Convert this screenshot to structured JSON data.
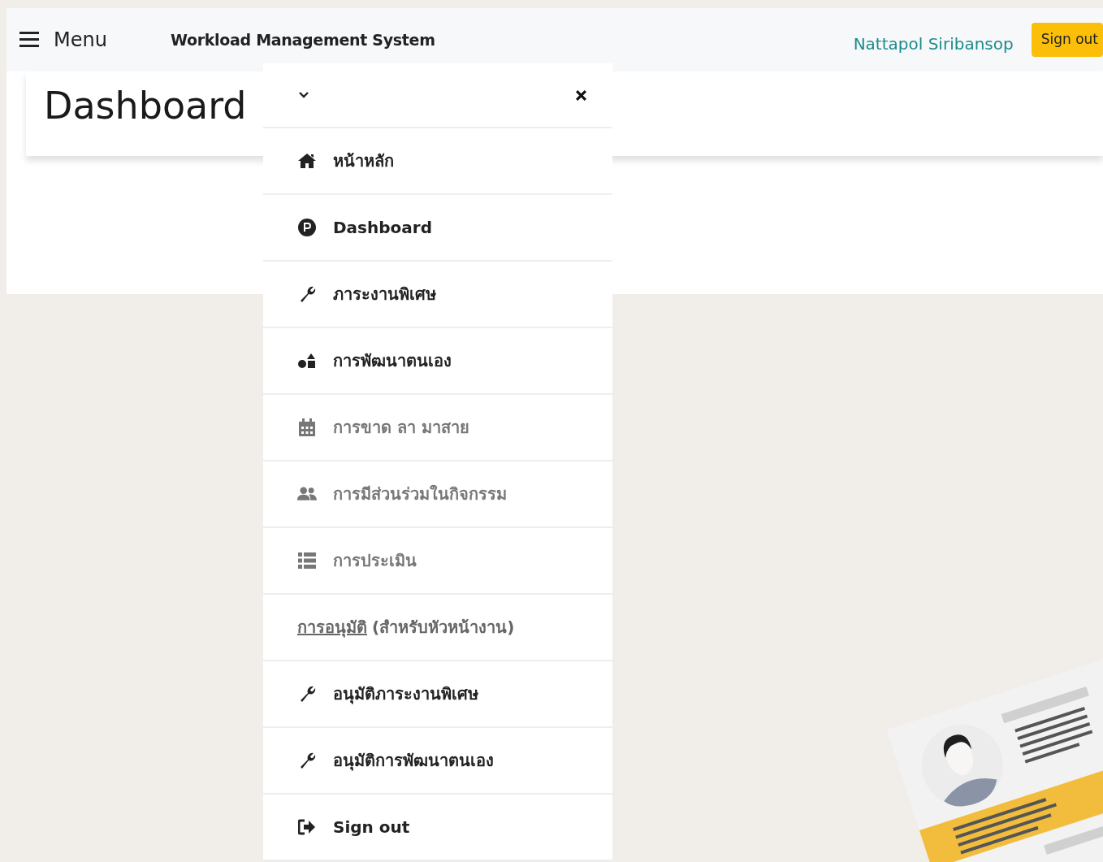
{
  "navbar": {
    "menu_label": "Menu",
    "title": "Workload Management System",
    "user": "Nattapol Siribansop",
    "sign_out": "Sign out"
  },
  "page": {
    "heading": "Dashboard"
  },
  "dropdown": {
    "items": [
      {
        "kind": "item",
        "label": "หน้าหลัก",
        "muted": false
      },
      {
        "kind": "item",
        "label": "Dashboard",
        "muted": false
      },
      {
        "kind": "item",
        "label": "ภาระงานพิเศษ",
        "muted": false
      },
      {
        "kind": "item",
        "label": "การพัฒนาตนเอง",
        "muted": false
      },
      {
        "kind": "item",
        "label": "การขาด ลา มาสาย",
        "muted": true
      },
      {
        "kind": "item",
        "label": "การมีส่วนร่วมในกิจกรรม",
        "muted": true
      },
      {
        "kind": "item",
        "label": "การประเมิน",
        "muted": true
      },
      {
        "kind": "heading",
        "link": "การอนุมัติ",
        "rest": "(สำหรับหัวหน้างาน)"
      },
      {
        "kind": "item",
        "label": "อนุมัติภาระงานพิเศษ",
        "muted": false
      },
      {
        "kind": "item",
        "label": "อนุมัติการพัฒนาตนเอง",
        "muted": false
      },
      {
        "kind": "item",
        "label": "Sign out",
        "muted": false
      }
    ]
  }
}
